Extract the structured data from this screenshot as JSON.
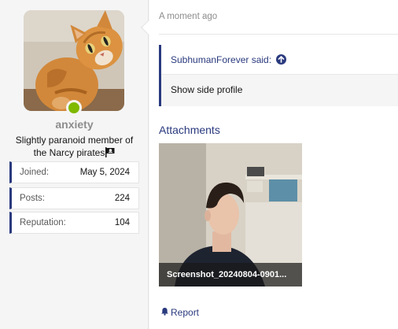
{
  "user": {
    "username": "anxiety",
    "title": "Slightly paranoid member of the Narcy pirates",
    "flag_icon": "pirate-flag-icon",
    "status": "online",
    "status_color": "#7fb900",
    "stats": [
      {
        "label": "Joined:",
        "value": "May 5, 2024"
      },
      {
        "label": "Posts:",
        "value": "224"
      },
      {
        "label": "Reputation:",
        "value": "104"
      }
    ]
  },
  "message": {
    "timestamp": "A moment ago",
    "quote": {
      "author_text": "SubhumanForever said:",
      "jump_icon": "arrow-up-circle-icon",
      "body": "Show side profile"
    },
    "attachments_title": "Attachments",
    "attachment": {
      "filename": "Screenshot_20240804-0901..."
    },
    "report_label": "Report",
    "report_icon": "bell-icon"
  },
  "colors": {
    "accent": "#2a3a7e",
    "online": "#7fb900"
  }
}
